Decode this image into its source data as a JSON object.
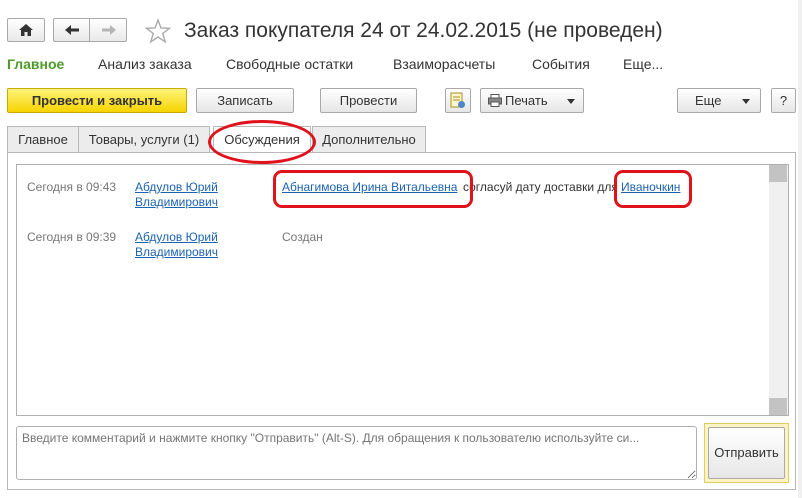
{
  "window": {
    "title": "Заказ покупателя 24 от 24.02.2015 (не проведен)"
  },
  "sections": [
    {
      "label": "Главное",
      "active": true
    },
    {
      "label": "Анализ заказа"
    },
    {
      "label": "Свободные остатки"
    },
    {
      "label": "Взаиморасчеты"
    },
    {
      "label": "События"
    },
    {
      "label": "Еще..."
    }
  ],
  "toolbar": {
    "post_close_label": "Провести и закрыть",
    "write_label": "Записать",
    "post_label": "Провести",
    "print_label": "Печать",
    "more_label": "Еще",
    "help_label": "?"
  },
  "tabs": [
    {
      "label": "Главное"
    },
    {
      "label": "Товары, услуги (1)"
    },
    {
      "label": "Обсуждения",
      "active": true
    },
    {
      "label": "Дополнительно"
    }
  ],
  "discussion": [
    {
      "time": "Сегодня в 09:43",
      "author_line1": "Абдулов Юрий",
      "author_line2": "Владимирович",
      "mention1": "Абнагимова Ирина Витальевна",
      "text": "согласуй дату доставки для",
      "mention2": "Иваночкин"
    },
    {
      "time": "Сегодня в 09:39",
      "author_line1": "Абдулов Юрий",
      "author_line2": "Владимирович",
      "status": "Создан"
    }
  ],
  "comment": {
    "placeholder": "Введите комментарий и нажмите кнопку \"Отправить\" (Alt-S). Для обращения к пользователю используйте си..."
  },
  "send_label": "Отправить",
  "colors": {
    "accent_green": "#4c9a2a",
    "primary_yellow": "#f6d400",
    "link_blue": "#1c63b0",
    "highlight_red": "#e0121b"
  }
}
